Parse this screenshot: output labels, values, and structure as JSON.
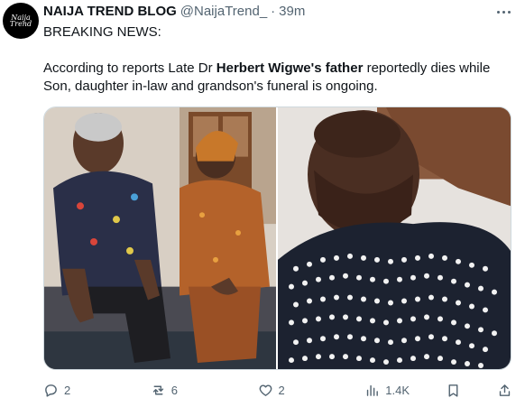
{
  "avatar": {
    "text": "Naija Trend"
  },
  "tweet": {
    "author_name": "NAIJA TREND BLOG",
    "handle": "@NaijaTrend_",
    "separator": "·",
    "time": "39m",
    "line1": "BREAKING NEWS:",
    "line2_a": "According to reports Late Dr ",
    "line2_bold": "Herbert Wigwe's father",
    "line2_b": " reportedly dies while Son, daughter in-law and grandson's funeral is ongoing."
  },
  "actions": {
    "replies": "2",
    "reposts": "6",
    "likes": "2",
    "views": "1.4K"
  },
  "colors": {
    "text": "#0f1419",
    "secondary": "#536471",
    "border": "#cfd9de",
    "repost_green": "#00ba7c"
  }
}
